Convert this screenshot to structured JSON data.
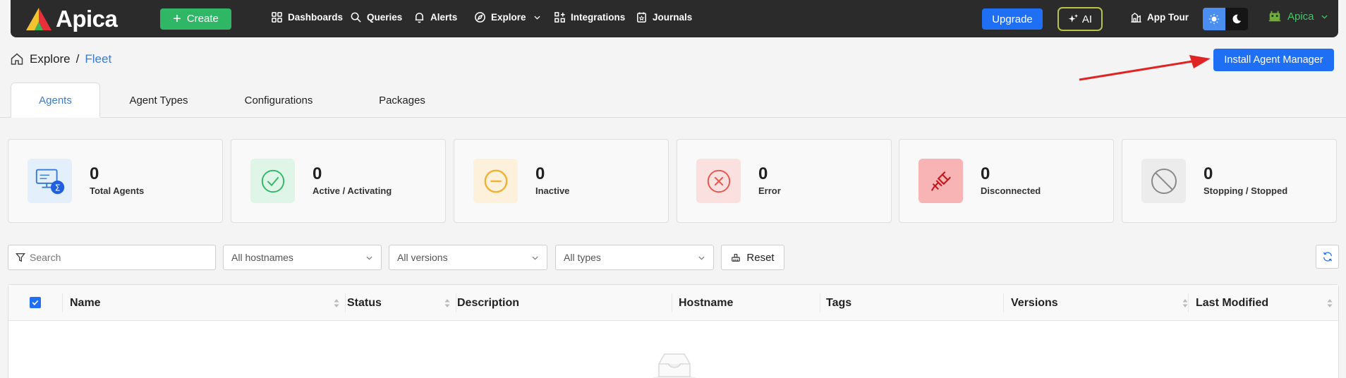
{
  "app": {
    "brand": "Apica",
    "create_label": "Create",
    "nav": [
      {
        "label": "Dashboards",
        "icon": "dashboards-icon"
      },
      {
        "label": "Queries",
        "icon": "queries-icon"
      },
      {
        "label": "Alerts",
        "icon": "bell-icon"
      },
      {
        "label": "Explore",
        "icon": "compass-icon"
      },
      {
        "label": "Integrations",
        "icon": "integrations-icon"
      },
      {
        "label": "Journals",
        "icon": "journals-icon"
      }
    ],
    "upgrade_label": "Upgrade",
    "ai_label": "AI",
    "app_tour_label": "App Tour",
    "user_label": "Apica"
  },
  "breadcrumb": {
    "root": "Explore",
    "separator": "/",
    "current": "Fleet"
  },
  "install_button": "Install Agent Manager",
  "tabs": [
    "Agents",
    "Agent Types",
    "Configurations",
    "Packages"
  ],
  "active_tab": "Agents",
  "stats": [
    {
      "value": "0",
      "label": "Total Agents",
      "color": "#3a7bd5"
    },
    {
      "value": "0",
      "label": "Active / Activating",
      "color": "#2fb765"
    },
    {
      "value": "0",
      "label": "Inactive",
      "color": "#f0b030"
    },
    {
      "value": "0",
      "label": "Error",
      "color": "#e8524a"
    },
    {
      "value": "0",
      "label": "Disconnected",
      "color": "#d9262b"
    },
    {
      "value": "0",
      "label": "Stopping / Stopped",
      "color": "#8a8a8a"
    }
  ],
  "filters": {
    "search_placeholder": "Search",
    "hostnames": "All hostnames",
    "versions": "All versions",
    "types": "All types",
    "reset_label": "Reset"
  },
  "table": {
    "columns": [
      "Name",
      "Status",
      "Description",
      "Hostname",
      "Tags",
      "Versions",
      "Last Modified"
    ],
    "rows": []
  },
  "colors": {
    "accent": "#1f6ff5",
    "create": "#2fb765",
    "topbar": "#2b2b2b",
    "annotation_arrow": "#e02424"
  }
}
